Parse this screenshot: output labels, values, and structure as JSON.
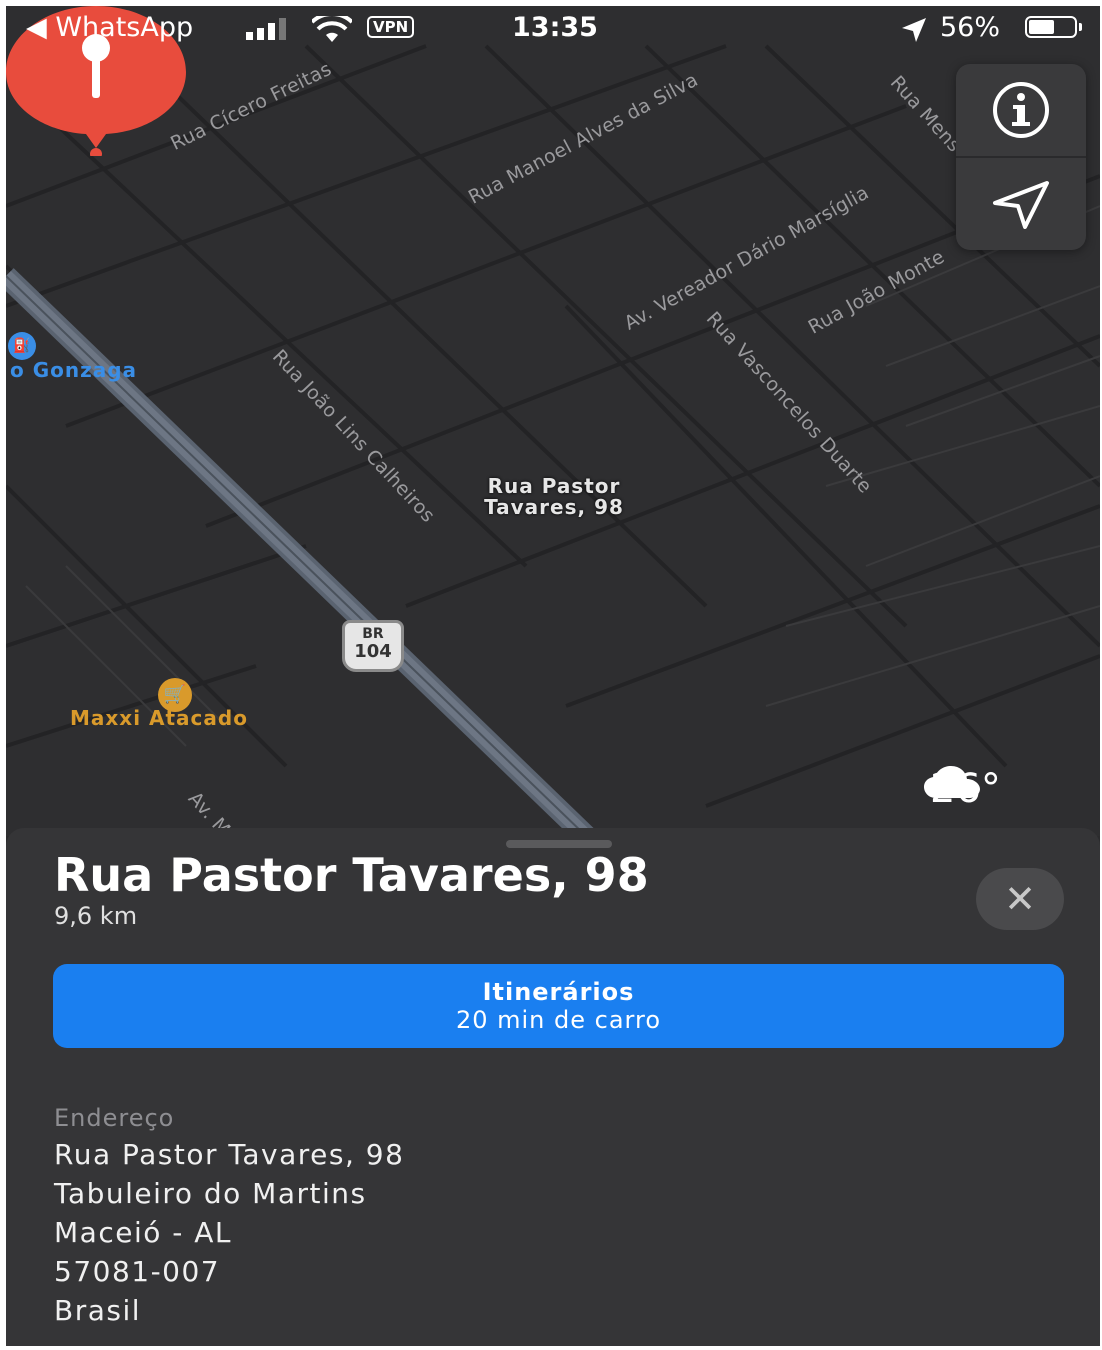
{
  "status_bar": {
    "back_app": "◀ WhatsApp",
    "vpn": "VPN",
    "time": "13:35",
    "battery_text": "56%",
    "battery_level": 0.56
  },
  "map": {
    "street_labels": [
      "Rua Cícero Freitas",
      "Rua Manoel Alves da Silva",
      "Av. Vereador Dário Marsíglia",
      "Rua João Monte",
      "Rua Vasconcelos Duarte",
      "Rua João Lins Calheiros",
      "Rua Mens",
      "Av. M"
    ],
    "poi_gonzaga": "o Gonzaga",
    "poi_maxxi": "Maxxi Atacado",
    "pin_label_line1": "Rua Pastor",
    "pin_label_line2": "Tavares, 98",
    "highway_shield_top": "BR",
    "highway_shield_num": "104",
    "weather_temp": "26°",
    "colors": {
      "pin": "#e84c3d",
      "poi_gonzaga": "#3a8ee6",
      "poi_maxxi": "#d99a2b"
    }
  },
  "controls": {
    "info_icon": "info-icon",
    "location_icon": "location-arrow-icon"
  },
  "sheet": {
    "title": "Rua Pastor Tavares, 98",
    "distance": "9,6 km",
    "close_symbol": "✕",
    "directions_title": "Itinerários",
    "directions_sub": "20 min de carro",
    "address_heading": "Endereço",
    "address_lines": [
      "Rua Pastor Tavares, 98",
      "Tabuleiro do Martins",
      "Maceió - AL",
      "57081-007",
      "Brasil"
    ],
    "accent": "#1a7ff0"
  }
}
